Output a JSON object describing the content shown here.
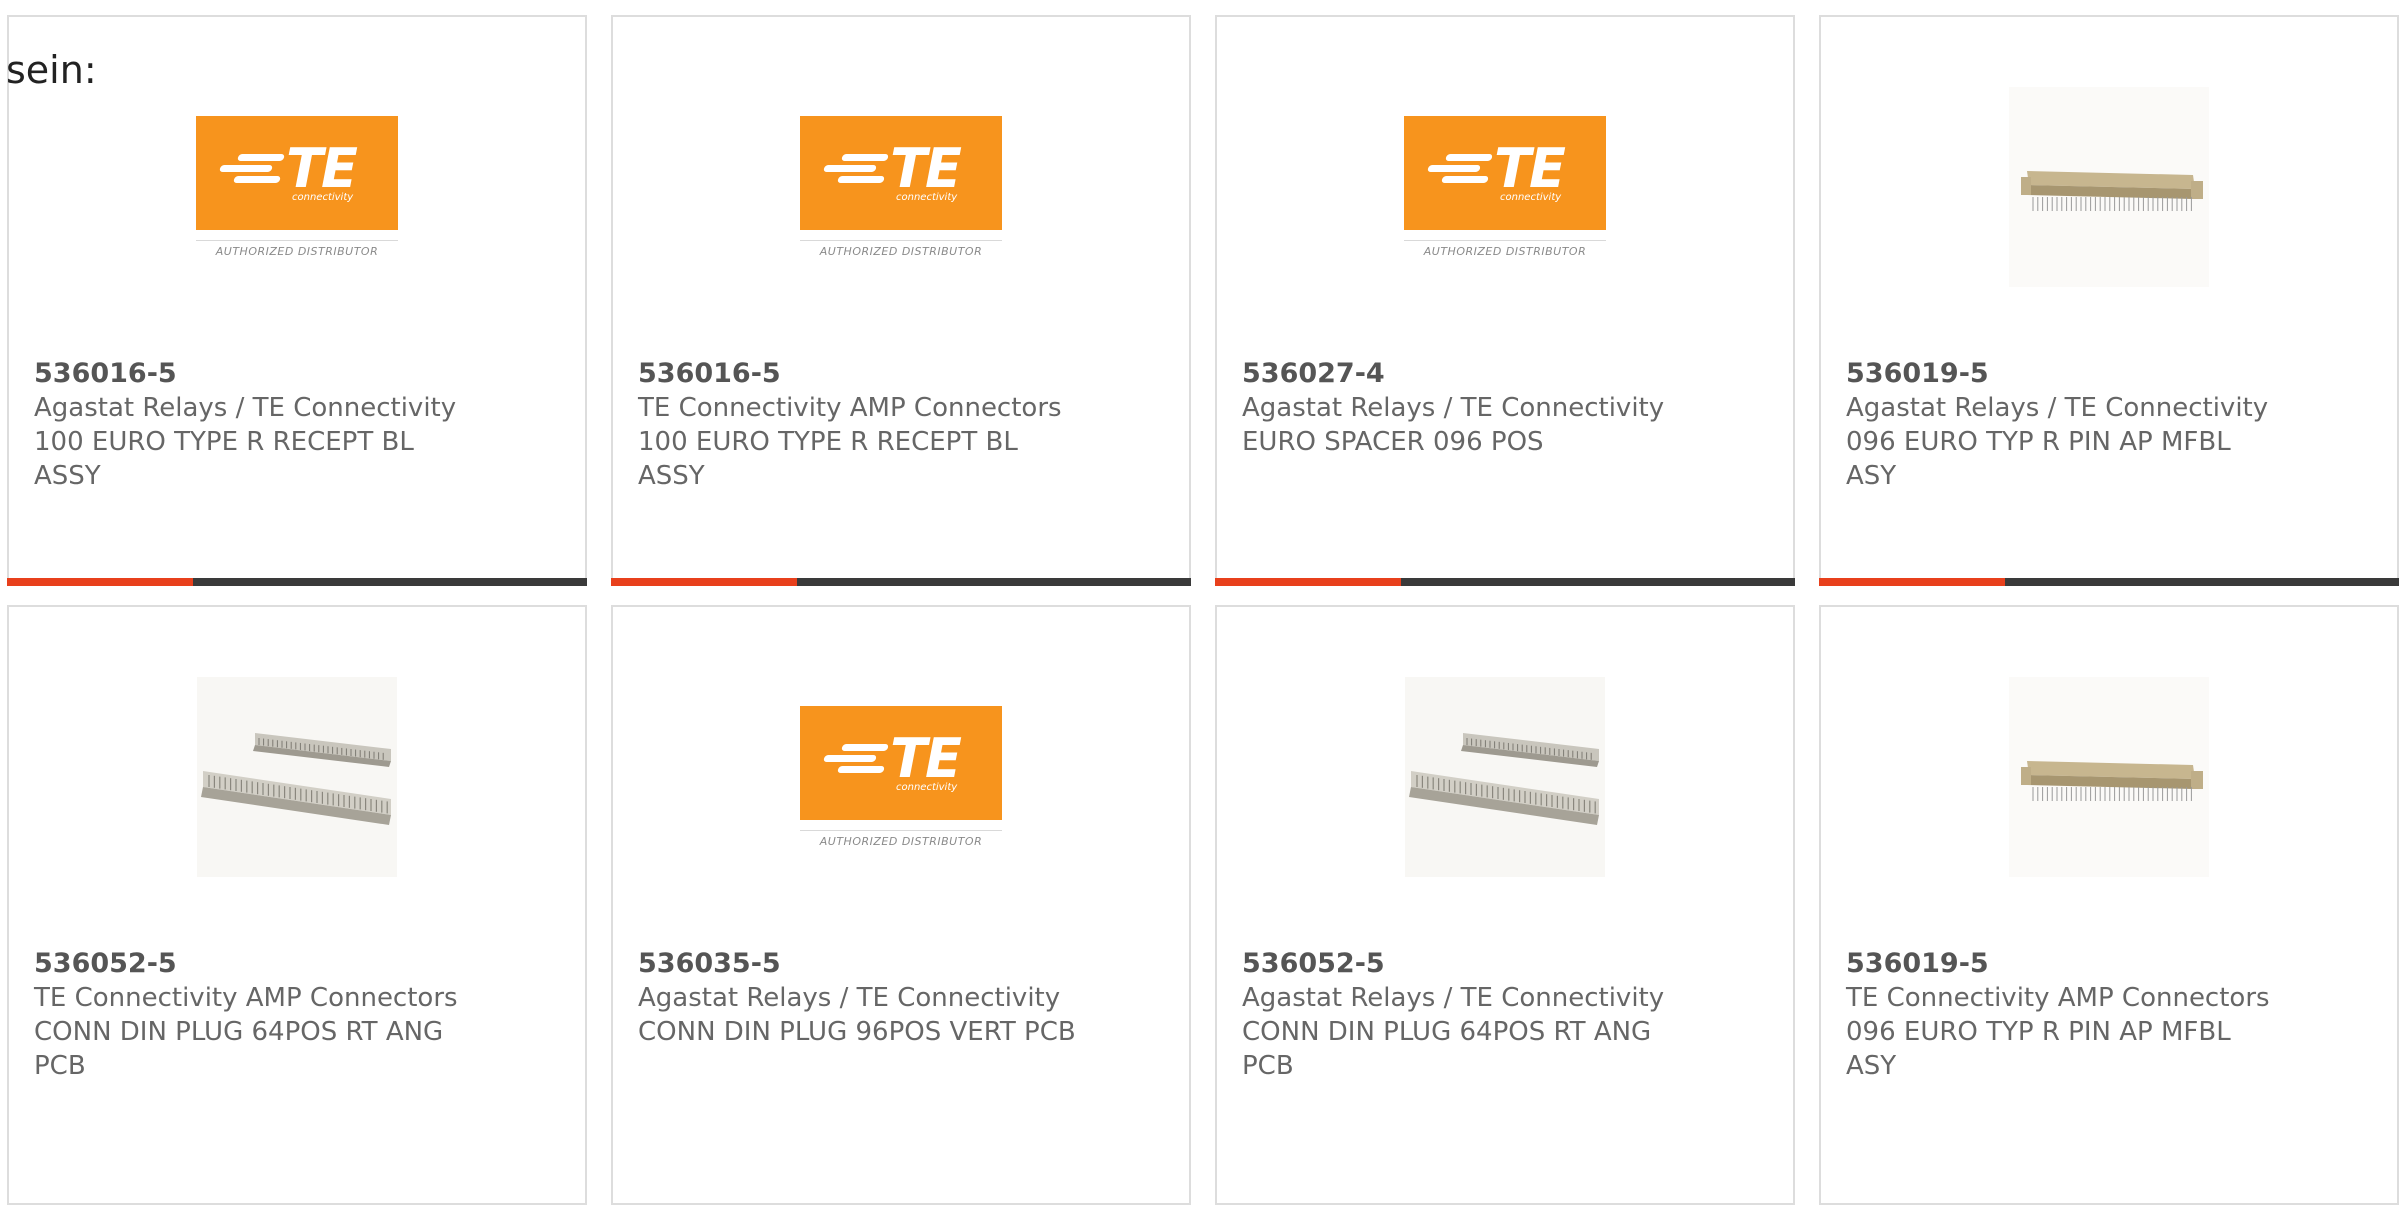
{
  "lead_text": "sein:",
  "brand": {
    "logo_mark": "TE",
    "logo_sub": "connectivity",
    "logo_footer": "AUTHORIZED DISTRIBUTOR",
    "accent": "#e8401c",
    "logo_orange": "#f7941d"
  },
  "cards": [
    {
      "part": "536016-5",
      "maker": "Agastat Relays / TE Connectivity",
      "desc": "100 EURO TYPE R RECEPT BL ASSY",
      "image": "te-logo",
      "progress": 0.32
    },
    {
      "part": "536016-5",
      "maker": "TE Connectivity AMP Connectors",
      "desc": "100 EURO TYPE R RECEPT BL ASSY",
      "image": "te-logo",
      "progress": 0.32
    },
    {
      "part": "536027-4",
      "maker": "Agastat Relays / TE Connectivity",
      "desc": "EURO SPACER 096 POS",
      "image": "te-logo",
      "progress": 0.32
    },
    {
      "part": "536019-5",
      "maker": "Agastat Relays / TE Connectivity",
      "desc": "096 EURO TYP R PIN AP MFBL ASY",
      "image": "pin-header",
      "progress": 0.32
    },
    {
      "part": "536052-5",
      "maker": "TE Connectivity AMP Connectors",
      "desc": "CONN DIN PLUG 64POS RT ANG PCB",
      "image": "din-pair",
      "progress": null
    },
    {
      "part": "536035-5",
      "maker": "Agastat Relays / TE Connectivity",
      "desc": "CONN DIN PLUG 96POS VERT PCB",
      "image": "te-logo",
      "progress": null
    },
    {
      "part": "536052-5",
      "maker": "Agastat Relays / TE Connectivity",
      "desc": "CONN DIN PLUG 64POS RT ANG PCB",
      "image": "din-pair",
      "progress": null
    },
    {
      "part": "536019-5",
      "maker": "TE Connectivity AMP Connectors",
      "desc": "096 EURO TYP R PIN AP MFBL ASY",
      "image": "pin-header",
      "progress": null
    }
  ]
}
